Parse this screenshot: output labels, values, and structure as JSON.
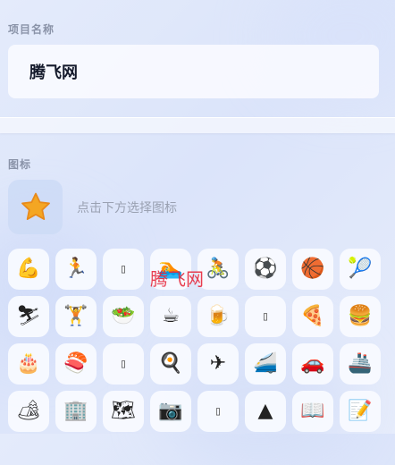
{
  "project": {
    "section_label": "项目名称",
    "name": "腾飞网"
  },
  "icon_section": {
    "section_label": "图标",
    "selected_icon": "star-icon",
    "hint": "点击下方选择图标"
  },
  "icons": [
    {
      "name": "flexed-biceps-icon",
      "glyph": "💪"
    },
    {
      "name": "running-person-icon",
      "glyph": "🏃"
    },
    {
      "name": "missing-glyph-icon",
      "glyph": "▯",
      "missing": true
    },
    {
      "name": "swimming-person-icon",
      "glyph": "🏊"
    },
    {
      "name": "cyclist-icon",
      "glyph": "🚴"
    },
    {
      "name": "soccer-ball-icon",
      "glyph": "⚽"
    },
    {
      "name": "basketball-hoop-icon",
      "glyph": "🏀"
    },
    {
      "name": "tennis-racket-icon",
      "glyph": "🎾"
    },
    {
      "name": "skier-icon",
      "glyph": "⛷"
    },
    {
      "name": "weightlifter-icon",
      "glyph": "🏋"
    },
    {
      "name": "food-bowl-icon",
      "glyph": "🥗"
    },
    {
      "name": "coffee-cup-icon",
      "glyph": "☕"
    },
    {
      "name": "beer-mug-icon",
      "glyph": "🍺"
    },
    {
      "name": "missing-glyph-icon",
      "glyph": "▯",
      "missing": true
    },
    {
      "name": "pizza-slice-icon",
      "glyph": "🍕"
    },
    {
      "name": "hamburger-icon",
      "glyph": "🍔"
    },
    {
      "name": "birthday-cake-icon",
      "glyph": "🎂"
    },
    {
      "name": "sushi-icon",
      "glyph": "🍣"
    },
    {
      "name": "missing-glyph-icon",
      "glyph": "▯",
      "missing": true
    },
    {
      "name": "frying-pan-icon",
      "glyph": "🍳"
    },
    {
      "name": "airplane-icon",
      "glyph": "✈"
    },
    {
      "name": "bullet-train-icon",
      "glyph": "🚄"
    },
    {
      "name": "car-icon",
      "glyph": "🚗"
    },
    {
      "name": "ship-icon",
      "glyph": "🚢"
    },
    {
      "name": "camping-icon",
      "glyph": "🏕"
    },
    {
      "name": "building-icon",
      "glyph": "🏢"
    },
    {
      "name": "world-map-icon",
      "glyph": "🗺"
    },
    {
      "name": "camera-icon",
      "glyph": "📷"
    },
    {
      "name": "missing-glyph-icon",
      "glyph": "▯",
      "missing": true
    },
    {
      "name": "triangle-up-icon",
      "glyph": "▲"
    },
    {
      "name": "open-book-icon",
      "glyph": "📖"
    },
    {
      "name": "memo-icon",
      "glyph": "📝"
    }
  ],
  "watermark": "腾飞网",
  "colors": {
    "accent_star": "#f4a623",
    "watermark": "#e6283c"
  }
}
